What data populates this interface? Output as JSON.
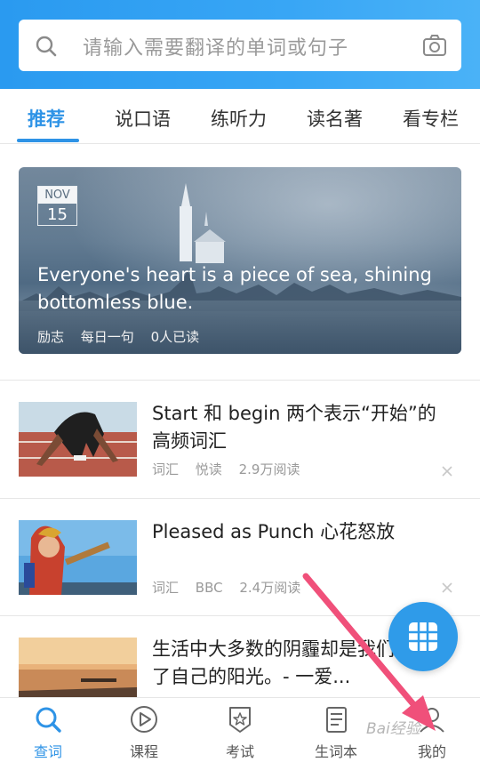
{
  "search": {
    "placeholder": "请输入需要翻译的单词或句子"
  },
  "tabs": [
    {
      "label": "推荐",
      "active": true
    },
    {
      "label": "说口语"
    },
    {
      "label": "练听力"
    },
    {
      "label": "读名著"
    },
    {
      "label": "看专栏"
    }
  ],
  "featured": {
    "month": "NOV",
    "day": "15",
    "quote": "Everyone's heart is a piece of sea, shining bottomless blue.",
    "tag": "励志",
    "category": "每日一句",
    "reads": "0人已读"
  },
  "articles": [
    {
      "title": "Start 和 begin 两个表示“开始”的高频词汇",
      "tag": "词汇",
      "source": "悦读",
      "reads": "2.9万阅读"
    },
    {
      "title": "Pleased as Punch 心花怒放",
      "tag": "词汇",
      "source": "BBC",
      "reads": "2.4万阅读"
    },
    {
      "title": "生活中大多数的阴霾却是我们挡住了自己的阳光。- 一爱..."
    }
  ],
  "bottom_nav": [
    {
      "label": "查词",
      "icon": "search-icon",
      "active": true
    },
    {
      "label": "课程",
      "icon": "play-icon"
    },
    {
      "label": "考试",
      "icon": "badge-star-icon"
    },
    {
      "label": "生词本",
      "icon": "notebook-icon"
    },
    {
      "label": "我的",
      "icon": "user-icon"
    }
  ],
  "watermark": "Bai经验",
  "colors": {
    "accent": "#2e93e6",
    "header": "#38a6f5",
    "arrow": "#f0507a"
  }
}
